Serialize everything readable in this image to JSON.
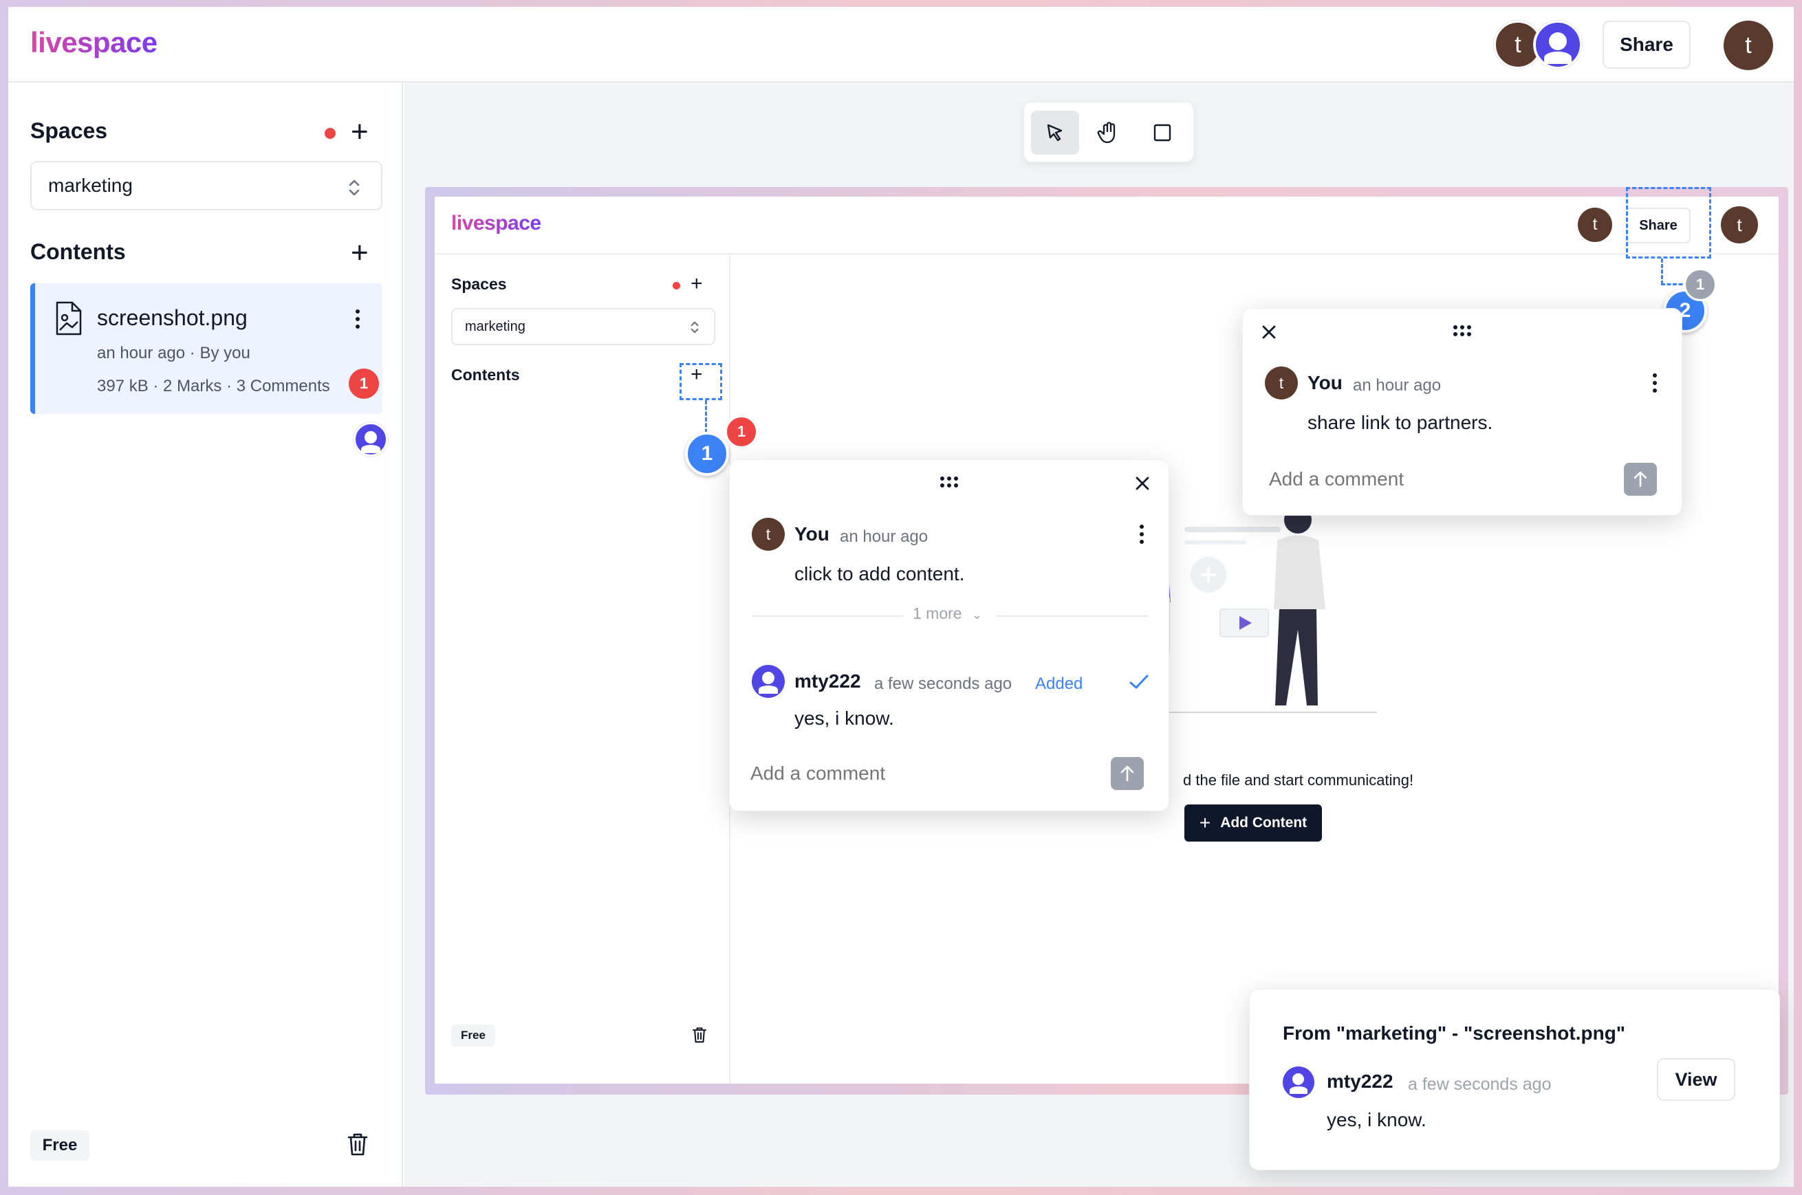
{
  "app": {
    "logo": "livespace",
    "share_label": "Share",
    "user_initial": "t"
  },
  "sidebar": {
    "spaces_title": "Spaces",
    "space_selected": "marketing",
    "contents_title": "Contents",
    "file": {
      "name": "screenshot.png",
      "meta": "an hour ago · By you",
      "stats": "397 kB · 2 Marks · 3 Comments",
      "badge": "1"
    },
    "plan": "Free"
  },
  "preview": {
    "logo": "livespace",
    "share_label": "Share",
    "user_initial": "t",
    "spaces_title": "Spaces",
    "space_selected": "marketing",
    "contents_title": "Contents",
    "plan": "Free",
    "empty_text": "d the file and start communicating!",
    "add_content_label": "Add Content"
  },
  "marker1": {
    "number": "1",
    "count": "1"
  },
  "marker2": {
    "number": "2",
    "count": "1"
  },
  "thread1": {
    "author": "You",
    "time": "an hour ago",
    "text": "click to add content.",
    "more": "1 more",
    "reply_author": "mty222",
    "reply_time": "a few seconds ago",
    "reply_status": "Added",
    "reply_text": "yes, i know.",
    "placeholder": "Add a comment",
    "author_initial": "t"
  },
  "thread2": {
    "author": "You",
    "time": "an hour ago",
    "text": "share link to partners.",
    "placeholder": "Add a comment",
    "author_initial": "t"
  },
  "toast": {
    "title": "From \"marketing\" - \"screenshot.png\"",
    "author": "mty222",
    "time": "a few seconds ago",
    "text": "yes, i know.",
    "view_label": "View"
  },
  "colors": {
    "accent": "#3b82f6",
    "badge": "#ef4444",
    "avatar_brown": "#5b3a2e",
    "avatar_user": "#4f46e5",
    "added": "#3b82f6"
  }
}
